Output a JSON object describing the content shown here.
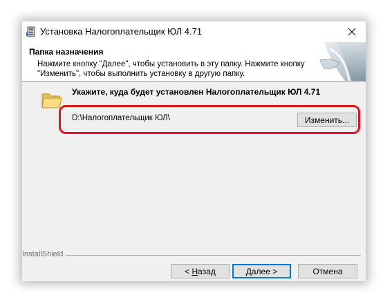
{
  "window": {
    "title": "Установка Налогоплательщик ЮЛ 4.71"
  },
  "header": {
    "title": "Папка назначения",
    "description": "Нажмите кнопку \"Далее\", чтобы установить в эту папку. Нажмите кнопку \"Изменить\", чтобы выполнить установку в другую папку."
  },
  "main": {
    "prompt": "Укажите, куда будет установлен Налогоплательщик ЮЛ 4.71",
    "install_path": "D:\\Налогоплательщик ЮЛ\\",
    "change_label": "Изменить...",
    "folder_icon": "folder-icon"
  },
  "footer": {
    "brand": "InstallShield",
    "back_prefix": "< ",
    "back_hotkey": "Н",
    "back_rest": "азад",
    "next_hotkey": "Д",
    "next_rest": "алее >",
    "cancel_label": "Отмена"
  },
  "colors": {
    "highlight": "#e8141c",
    "default_button_border": "#0078d7",
    "dialog_background": "#f0f0f0"
  }
}
